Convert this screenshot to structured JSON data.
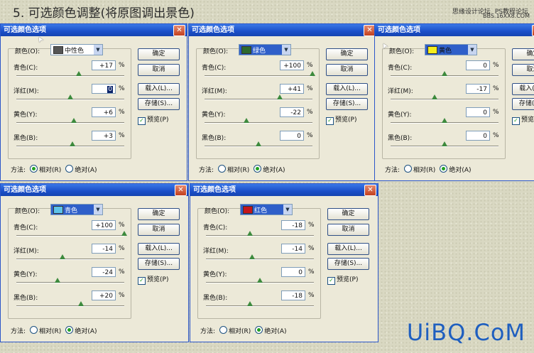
{
  "heading": "5. 可选颜色调整(将原图调出景色)",
  "site": {
    "left": "思缘设计论坛",
    "right": "PS教程论坛",
    "url": "BBS.16XX8.COM"
  },
  "watermark": "UiBQ.CoM",
  "dialog_title": "可选颜色选项",
  "color_label": "颜色(O):",
  "row_labels": [
    "青色(C):",
    "洋红(M):",
    "黄色(Y):",
    "黑色(B):"
  ],
  "pct": "%",
  "buttons": {
    "ok": "确定",
    "cancel": "取消",
    "load": "载入(L)...",
    "save": "存储(S)...",
    "preview": "预览(P)"
  },
  "method_label": "方法:",
  "method_relative": "相对(R)",
  "method_absolute": "绝对(A)",
  "dialogs": [
    {
      "color": "中性色",
      "swatch": "#555555",
      "values": [
        "+17",
        "0",
        "+6",
        "+3"
      ],
      "sliders": [
        0.58,
        0.5,
        0.53,
        0.52
      ],
      "method": "relative"
    },
    {
      "color": "绿色",
      "swatch": "#2e6a2e",
      "values": [
        "+100",
        "+41",
        "-22",
        "0"
      ],
      "sliders": [
        1.0,
        0.7,
        0.39,
        0.5
      ],
      "method": "absolute"
    },
    {
      "color": "黄色",
      "swatch": "#f5ee1c",
      "values": [
        "0",
        "-17",
        "0",
        "0"
      ],
      "sliders": [
        0.5,
        0.41,
        0.5,
        0.5
      ],
      "method": "absolute"
    },
    {
      "color": "青色",
      "swatch": "#5ec3ea",
      "values": [
        "+100",
        "-14",
        "-24",
        "+20"
      ],
      "sliders": [
        1.0,
        0.43,
        0.38,
        0.6
      ],
      "method": "absolute"
    },
    {
      "color": "红色",
      "swatch": "#c4161c",
      "values": [
        "-18",
        "-14",
        "0",
        "-18"
      ],
      "sliders": [
        0.41,
        0.43,
        0.5,
        0.41
      ],
      "method": "absolute"
    }
  ]
}
